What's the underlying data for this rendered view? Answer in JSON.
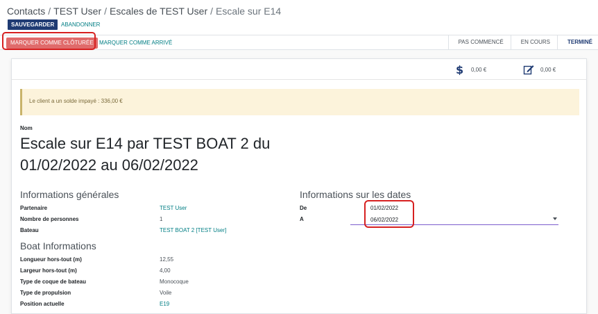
{
  "breadcrumb": {
    "items": [
      "Contacts",
      "TEST User",
      "Escales de TEST User"
    ],
    "current": "Escale sur E14",
    "separator": "/"
  },
  "toolbar": {
    "save_label": "SAUVEGARDER",
    "discard_label": "ABANDONNER"
  },
  "statusbar": {
    "close_label": "MARQUER COMME CLÔTURÉE",
    "arrived_label": "MARQUER COMME ARRIVÉ",
    "stages": [
      "PAS COMMENCÉ",
      "EN COURS",
      "TERMINÉ"
    ],
    "current_stage": "TERMINÉ"
  },
  "stats": [
    {
      "icon": "dollar-icon",
      "value": "0,00 €"
    },
    {
      "icon": "edit-icon",
      "value": "0,00 €"
    }
  ],
  "alert": "Le client a un solde impayé : 336,00 €",
  "record": {
    "name_label": "Nom",
    "title": "Escale sur E14 par TEST BOAT 2 du 01/02/2022 au 06/02/2022"
  },
  "general": {
    "title": "Informations générales",
    "partner_label": "Partenaire",
    "partner_value": "TEST User",
    "persons_label": "Nombre de personnes",
    "persons_value": "1",
    "boat_label": "Bateau",
    "boat_value": "TEST BOAT 2 [TEST User]"
  },
  "boat": {
    "title": "Boat Informations",
    "length_label": "Longueur hors-tout (m)",
    "length_value": "12,55",
    "width_label": "Largeur hors-tout (m)",
    "width_value": "4,00",
    "hull_label": "Type de coque de bateau",
    "hull_value": "Monocoque",
    "propulsion_label": "Type de propulsion",
    "propulsion_value": "Voile",
    "position_label": "Position actuelle",
    "position_value": "E19"
  },
  "dates": {
    "title": "Informations sur les dates",
    "from_label": "De",
    "from_value": "01/02/2022",
    "to_label": "A",
    "to_value": "06/02/2022"
  },
  "colors": {
    "primary": "#1f3b73",
    "link": "#017e84",
    "danger_button": "#e06b6b",
    "highlight": "#d62020",
    "alert_bg": "#fcf3db",
    "focus_line": "#7b5ccc"
  }
}
